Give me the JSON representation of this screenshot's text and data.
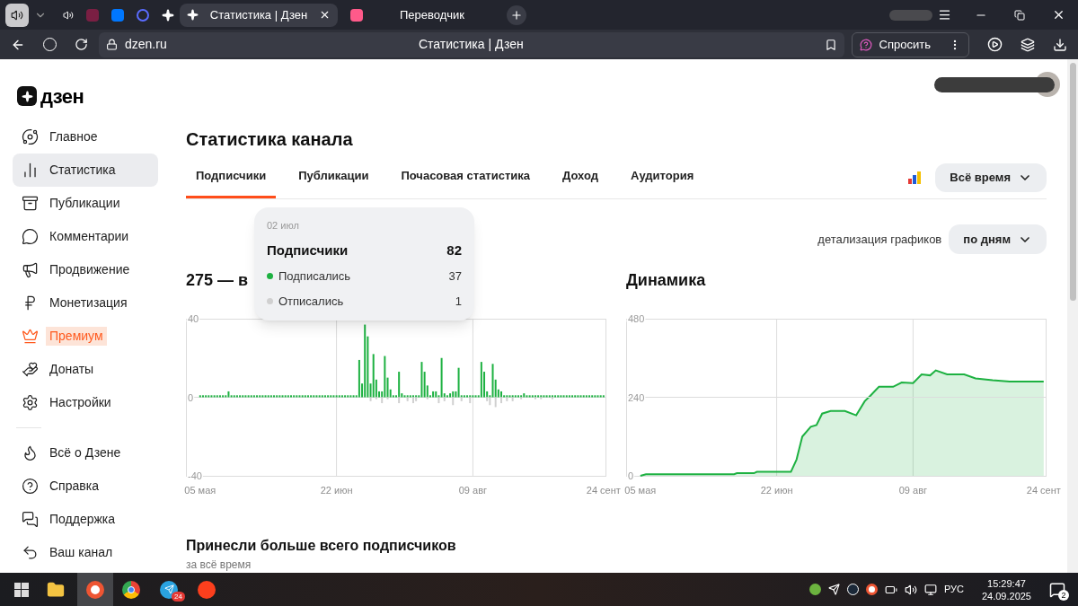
{
  "browser": {
    "tabs": [
      {
        "title": "Статистика | Дзен",
        "selected": true
      },
      {
        "title": "Переводчик",
        "selected": false
      }
    ],
    "address": "dzen.ru",
    "page_title": "Статистика | Дзен",
    "ask_button": "Спросить"
  },
  "sidebar": {
    "logo": "дзен",
    "items": [
      {
        "label": "Главное",
        "selected": false,
        "kind": "plain"
      },
      {
        "label": "Статистика",
        "selected": true,
        "kind": "plain"
      },
      {
        "label": "Публикации",
        "selected": false,
        "kind": "plain"
      },
      {
        "label": "Комментарии",
        "selected": false,
        "kind": "plain"
      },
      {
        "label": "Продвижение",
        "selected": false,
        "kind": "plain"
      },
      {
        "label": "Монетизация",
        "selected": false,
        "kind": "plain"
      },
      {
        "label": "Премиум",
        "selected": false,
        "kind": "premium"
      },
      {
        "label": "Донаты",
        "selected": false,
        "kind": "plain"
      },
      {
        "label": "Настройки",
        "selected": false,
        "kind": "plain"
      }
    ],
    "secondary_items": [
      {
        "label": "Всё о Дзене",
        "selected": false
      },
      {
        "label": "Справка",
        "selected": false
      },
      {
        "label": "Поддержка",
        "selected": false
      },
      {
        "label": "Ваш канал",
        "selected": false
      }
    ]
  },
  "page": {
    "title": "Статистика канала",
    "tabs": [
      {
        "label": "Подписчики",
        "selected": true
      },
      {
        "label": "Публикации",
        "selected": false
      },
      {
        "label": "Почасовая статистика",
        "selected": false
      },
      {
        "label": "Доход",
        "selected": false
      },
      {
        "label": "Аудитория",
        "selected": false
      }
    ],
    "period_button": "Всё время",
    "detail_label": "детализация графиков",
    "detail_button": "по дням",
    "tooltip": {
      "date": "02 июл",
      "title": "Подписчики",
      "total": "82",
      "rows": [
        {
          "label": "Подписались",
          "value": "37",
          "color": "#1db141"
        },
        {
          "label": "Отписались",
          "value": "1",
          "color": "#d0d0d0"
        }
      ]
    },
    "charts": [
      {
        "heading": "275 — в",
        "chart_data": {
          "type": "bar",
          "stacked": true,
          "grid": true,
          "ylim": [
            -40,
            40
          ],
          "yticks": [
            -40,
            0,
            40
          ],
          "xlim": [
            "2025-04-30",
            "2025-09-25"
          ],
          "xticks": [
            {
              "value": "2025-05-05",
              "label": "05 мая"
            },
            {
              "value": "2025-06-22",
              "label": "22 июн"
            },
            {
              "value": "2025-08-09",
              "label": "09 авг"
            },
            {
              "value": "2025-09-24",
              "label": "24 сент"
            }
          ],
          "x": [
            "2025-05-05",
            "2025-05-06",
            "2025-05-07",
            "2025-05-08",
            "2025-05-09",
            "2025-05-10",
            "2025-05-11",
            "2025-05-12",
            "2025-05-13",
            "2025-05-14",
            "2025-05-15",
            "2025-05-16",
            "2025-05-17",
            "2025-05-18",
            "2025-05-19",
            "2025-05-20",
            "2025-05-21",
            "2025-05-22",
            "2025-05-23",
            "2025-05-24",
            "2025-05-25",
            "2025-05-26",
            "2025-05-27",
            "2025-05-28",
            "2025-05-29",
            "2025-05-30",
            "2025-05-31",
            "2025-06-01",
            "2025-06-02",
            "2025-06-03",
            "2025-06-04",
            "2025-06-05",
            "2025-06-06",
            "2025-06-07",
            "2025-06-08",
            "2025-06-09",
            "2025-06-10",
            "2025-06-11",
            "2025-06-12",
            "2025-06-13",
            "2025-06-14",
            "2025-06-15",
            "2025-06-16",
            "2025-06-17",
            "2025-06-18",
            "2025-06-19",
            "2025-06-20",
            "2025-06-21",
            "2025-06-22",
            "2025-06-23",
            "2025-06-24",
            "2025-06-25",
            "2025-06-26",
            "2025-06-27",
            "2025-06-28",
            "2025-06-29",
            "2025-06-30",
            "2025-07-01",
            "2025-07-02",
            "2025-07-03",
            "2025-07-04",
            "2025-07-05",
            "2025-07-06",
            "2025-07-07",
            "2025-07-08",
            "2025-07-09",
            "2025-07-10",
            "2025-07-11",
            "2025-07-12",
            "2025-07-13",
            "2025-07-14",
            "2025-07-15",
            "2025-07-16",
            "2025-07-17",
            "2025-07-18",
            "2025-07-19",
            "2025-07-20",
            "2025-07-21",
            "2025-07-22",
            "2025-07-23",
            "2025-07-24",
            "2025-07-25",
            "2025-07-26",
            "2025-07-27",
            "2025-07-28",
            "2025-07-29",
            "2025-07-30",
            "2025-07-31",
            "2025-08-01",
            "2025-08-02",
            "2025-08-03",
            "2025-08-04",
            "2025-08-05",
            "2025-08-06",
            "2025-08-07",
            "2025-08-08",
            "2025-08-09",
            "2025-08-10",
            "2025-08-11",
            "2025-08-12",
            "2025-08-13",
            "2025-08-14",
            "2025-08-15",
            "2025-08-16",
            "2025-08-17",
            "2025-08-18",
            "2025-08-19",
            "2025-08-20",
            "2025-08-21",
            "2025-08-22",
            "2025-08-23",
            "2025-08-24",
            "2025-08-25",
            "2025-08-26",
            "2025-08-27",
            "2025-08-28",
            "2025-08-29",
            "2025-08-30",
            "2025-08-31",
            "2025-09-01",
            "2025-09-02",
            "2025-09-03",
            "2025-09-04",
            "2025-09-05",
            "2025-09-06",
            "2025-09-07",
            "2025-09-08",
            "2025-09-09",
            "2025-09-10",
            "2025-09-11",
            "2025-09-12",
            "2025-09-13",
            "2025-09-14",
            "2025-09-15",
            "2025-09-16",
            "2025-09-17",
            "2025-09-18",
            "2025-09-19",
            "2025-09-20",
            "2025-09-21",
            "2025-09-22",
            "2025-09-23",
            "2025-09-24"
          ],
          "series": [
            {
              "color": "#1db141",
              "values": [
                1,
                1,
                1,
                1,
                1,
                1,
                1,
                1,
                1,
                1,
                3,
                1,
                1,
                1,
                1,
                1,
                1,
                1,
                1,
                1,
                1,
                1,
                1,
                1,
                1,
                1,
                1,
                1,
                1,
                1,
                1,
                1,
                1,
                1,
                1,
                1,
                1,
                1,
                1,
                1,
                1,
                1,
                1,
                1,
                1,
                1,
                1,
                1,
                1,
                1,
                1,
                1,
                1,
                1,
                1,
                1,
                19,
                7,
                37,
                31,
                7,
                22,
                9,
                3,
                3,
                21,
                10,
                4,
                1,
                1,
                13,
                2,
                1,
                1,
                1,
                1,
                1,
                1,
                18,
                13,
                6,
                1,
                3,
                3,
                1,
                20,
                2,
                1,
                2,
                3,
                3,
                15,
                1,
                1,
                1,
                1,
                1,
                1,
                1,
                18,
                13,
                3,
                1,
                17,
                9,
                4,
                3,
                1,
                1,
                1,
                1,
                1,
                1,
                1,
                2,
                1,
                1,
                1,
                1,
                1,
                1,
                1,
                1,
                1,
                1,
                1,
                1,
                1,
                1,
                1,
                1,
                1,
                1,
                1,
                1,
                1,
                1,
                1,
                1,
                1,
                1,
                1,
                1
              ]
            },
            {
              "color": "#d0d0d0",
              "values": [
                0,
                0,
                0,
                0,
                0,
                0,
                0,
                0,
                0,
                0,
                0,
                0,
                0,
                0,
                0,
                0,
                0,
                0,
                0,
                0,
                0,
                0,
                0,
                0,
                0,
                0,
                0,
                0,
                0,
                0,
                0,
                0,
                0,
                0,
                0,
                0,
                0,
                0,
                0,
                0,
                0,
                0,
                0,
                0,
                0,
                0,
                0,
                0,
                0,
                0,
                0,
                0,
                0,
                0,
                0,
                0,
                0,
                0,
                0,
                0,
                -2,
                0,
                -1,
                0,
                -3,
                0,
                -1,
                0,
                0,
                0,
                -3,
                0,
                0,
                -2,
                0,
                -3,
                -2,
                0,
                0,
                0,
                -1,
                0,
                0,
                0,
                -3,
                0,
                -2,
                0,
                0,
                -4,
                0,
                0,
                -2,
                0,
                0,
                -3,
                0,
                0,
                0,
                0,
                0,
                -2,
                -4,
                0,
                -5,
                0,
                -3,
                0,
                -2,
                0,
                -2,
                0,
                0,
                -1,
                0,
                0,
                0,
                0,
                -1,
                0,
                -1,
                0,
                0,
                0,
                -1,
                0,
                0,
                0,
                0,
                0,
                0,
                0,
                0,
                0,
                0,
                0,
                0,
                0,
                0,
                0,
                0,
                0,
                0
              ]
            }
          ]
        }
      },
      {
        "heading": "Динамика",
        "chart_data": {
          "type": "area",
          "grid": true,
          "ylim": [
            0,
            480
          ],
          "yticks": [
            0,
            240,
            480
          ],
          "xlim": [
            "2025-04-30",
            "2025-09-25"
          ],
          "xticks": [
            {
              "value": "2025-05-05",
              "label": "05 мая"
            },
            {
              "value": "2025-06-22",
              "label": "22 июн"
            },
            {
              "value": "2025-08-09",
              "label": "09 авг"
            },
            {
              "value": "2025-09-24",
              "label": "24 сент"
            }
          ],
          "x": [
            "2025-05-05",
            "2025-05-07",
            "2025-06-07",
            "2025-06-08",
            "2025-06-14",
            "2025-06-15",
            "2025-06-27",
            "2025-06-29",
            "2025-07-01",
            "2025-07-04",
            "2025-07-06",
            "2025-07-08",
            "2025-07-11",
            "2025-07-16",
            "2025-07-20",
            "2025-07-23",
            "2025-07-25",
            "2025-07-28",
            "2025-08-02",
            "2025-08-05",
            "2025-08-09",
            "2025-08-12",
            "2025-08-15",
            "2025-08-17",
            "2025-08-21",
            "2025-08-27",
            "2025-08-31",
            "2025-09-06",
            "2025-09-12",
            "2025-09-24"
          ],
          "series": [
            {
              "color": "#1db141",
              "values": [
                0,
                5,
                5,
                8,
                8,
                12,
                12,
                50,
                120,
                150,
                155,
                190,
                198,
                198,
                185,
                228,
                245,
                272,
                272,
                285,
                283,
                310,
                307,
                322,
                310,
                310,
                298,
                292,
                288,
                288
              ]
            }
          ]
        }
      }
    ],
    "bottom_title": "Принесли больше всего подписчиков",
    "bottom_subtitle": "за всё время"
  },
  "taskbar": {
    "telegram_badge": "24",
    "language": "РУС",
    "time": "15:29:47",
    "date": "24.09.2025",
    "notifications": "2"
  }
}
